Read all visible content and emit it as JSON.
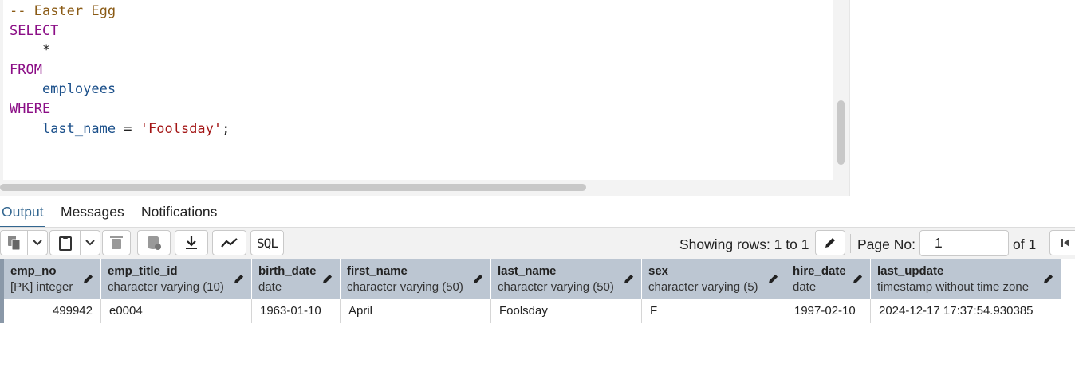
{
  "editor": {
    "lines": [
      [
        {
          "t": "-- Easter Egg",
          "c": "comment"
        }
      ],
      [
        {
          "t": "SELECT",
          "c": "keyword"
        }
      ],
      [
        {
          "t": "    *",
          "c": "plain"
        }
      ],
      [
        {
          "t": "FROM",
          "c": "keyword"
        }
      ],
      [
        {
          "t": "    employees",
          "c": "ident"
        }
      ],
      [
        {
          "t": "WHERE",
          "c": "keyword"
        }
      ],
      [
        {
          "t": "    last_name",
          "c": "ident"
        },
        {
          "t": " = ",
          "c": "plain"
        },
        {
          "t": "'Foolsday'",
          "c": "string"
        },
        {
          "t": ";",
          "c": "plain"
        }
      ]
    ]
  },
  "tabs": [
    {
      "label": "Output",
      "active": true
    },
    {
      "label": "Messages",
      "active": false
    },
    {
      "label": "Notifications",
      "active": false
    }
  ],
  "toolbar": {
    "sql_label": "SQL",
    "showing_rows": "Showing rows: 1 to 1",
    "page_label": "Page No:",
    "page_value": "1",
    "of_label": "of 1"
  },
  "grid": {
    "columns": [
      {
        "name": "emp_no",
        "type": "[PK] integer"
      },
      {
        "name": "emp_title_id",
        "type": "character varying (10)"
      },
      {
        "name": "birth_date",
        "type": "date"
      },
      {
        "name": "first_name",
        "type": "character varying (50)"
      },
      {
        "name": "last_name",
        "type": "character varying (50)"
      },
      {
        "name": "sex",
        "type": "character varying (5)"
      },
      {
        "name": "hire_date",
        "type": "date"
      },
      {
        "name": "last_update",
        "type": "timestamp without time zone"
      }
    ],
    "rows": [
      [
        "499942",
        "e0004",
        "1963-01-10",
        "April",
        "Foolsday",
        "F",
        "1997-02-10",
        "2024-12-17 17:37:54.930385"
      ]
    ]
  },
  "colors": {
    "keyword": "#8b0e86",
    "comment": "#8a5a14",
    "ident": "#1a4f8a",
    "string": "#a31515",
    "accent": "#326690",
    "header_bg": "#bcc6d2"
  }
}
